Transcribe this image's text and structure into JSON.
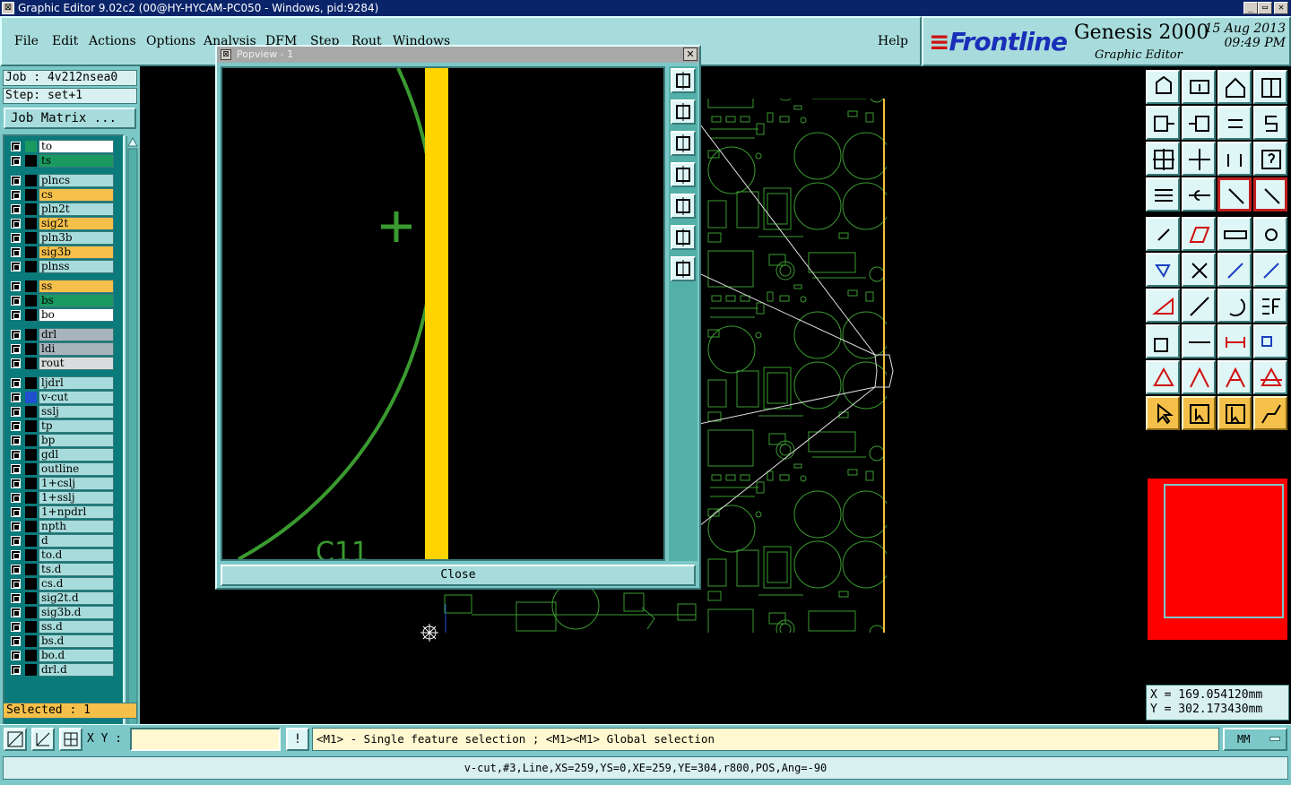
{
  "window": {
    "title": "Graphic Editor 9.02c2 (00@HY-HYCAM-PC050 - Windows, pid:9284)",
    "min_glyph": "_",
    "max_glyph": "▭",
    "close_glyph": "✕"
  },
  "menu": {
    "file": "File",
    "edit": "Edit",
    "actions": "Actions",
    "options": "Options",
    "analysis": "Analysis",
    "dfm": "DFM",
    "step": "Step",
    "rout": "Rout",
    "windows": "Windows",
    "help": "Help"
  },
  "brand": {
    "logo_stripes": "≡",
    "logo": "Frontline",
    "product": "Genesis 2000",
    "subtitle": "Graphic Editor",
    "date": "15 Aug 2013",
    "time": "09:49 PM"
  },
  "job": {
    "job_label": "Job : 4v212nsea0",
    "step_label": "Step: set+1",
    "matrix_button": "Job Matrix ..."
  },
  "layers": [
    {
      "name": "to",
      "color": "#ffffff",
      "swatch": "#1a9a60"
    },
    {
      "name": "ts",
      "color": "#1a9a60",
      "swatch": "#000000"
    },
    {
      "name": "plncs",
      "color": "#a8dcdc",
      "swatch": "#000000"
    },
    {
      "name": "cs",
      "color": "#f5c04a",
      "swatch": "#000000"
    },
    {
      "name": "pln2t",
      "color": "#a8dcdc",
      "swatch": "#000000"
    },
    {
      "name": "sig2t",
      "color": "#f5c04a",
      "swatch": "#000000"
    },
    {
      "name": "pln3b",
      "color": "#a8dcdc",
      "swatch": "#000000"
    },
    {
      "name": "sig3b",
      "color": "#f5c04a",
      "swatch": "#000000"
    },
    {
      "name": "plnss",
      "color": "#a8dcdc",
      "swatch": "#000000"
    },
    {
      "name": "ss",
      "color": "#f5c04a",
      "swatch": "#000000"
    },
    {
      "name": "bs",
      "color": "#1a9a60",
      "swatch": "#000000"
    },
    {
      "name": "bo",
      "color": "#ffffff",
      "swatch": "#000000"
    },
    {
      "name": "drl",
      "color": "#a8b4bc",
      "swatch": "#000000"
    },
    {
      "name": "ldi",
      "color": "#a8b4bc",
      "swatch": "#000000"
    },
    {
      "name": "rout",
      "color": "#d8dcdc",
      "swatch": "#000000"
    },
    {
      "name": "ljdrl",
      "color": "#a8dcdc",
      "swatch": "#000000"
    },
    {
      "name": "v-cut",
      "color": "#a8dcdc",
      "swatch": "#2050d0"
    },
    {
      "name": "sslj",
      "color": "#a8dcdc",
      "swatch": "#000000"
    },
    {
      "name": "tp",
      "color": "#a8dcdc",
      "swatch": "#000000"
    },
    {
      "name": "bp",
      "color": "#a8dcdc",
      "swatch": "#000000"
    },
    {
      "name": "gdl",
      "color": "#a8dcdc",
      "swatch": "#000000"
    },
    {
      "name": "outline",
      "color": "#a8dcdc",
      "swatch": "#000000"
    },
    {
      "name": "1+cslj",
      "color": "#a8dcdc",
      "swatch": "#000000"
    },
    {
      "name": "1+sslj",
      "color": "#a8dcdc",
      "swatch": "#000000"
    },
    {
      "name": "1+npdrl",
      "color": "#a8dcdc",
      "swatch": "#000000"
    },
    {
      "name": "npth",
      "color": "#a8dcdc",
      "swatch": "#000000"
    },
    {
      "name": "d",
      "color": "#a8dcdc",
      "swatch": "#000000"
    },
    {
      "name": "to.d",
      "color": "#a8dcdc",
      "swatch": "#000000"
    },
    {
      "name": "ts.d",
      "color": "#a8dcdc",
      "swatch": "#000000"
    },
    {
      "name": "cs.d",
      "color": "#a8dcdc",
      "swatch": "#000000"
    },
    {
      "name": "sig2t.d",
      "color": "#a8dcdc",
      "swatch": "#000000"
    },
    {
      "name": "sig3b.d",
      "color": "#a8dcdc",
      "swatch": "#000000"
    },
    {
      "name": "ss.d",
      "color": "#a8dcdc",
      "swatch": "#000000"
    },
    {
      "name": "bs.d",
      "color": "#a8dcdc",
      "swatch": "#000000"
    },
    {
      "name": "bo.d",
      "color": "#a8dcdc",
      "swatch": "#000000"
    },
    {
      "name": "drl.d",
      "color": "#a8dcdc",
      "swatch": "#000000"
    }
  ],
  "selected": "Selected : 1",
  "popview": {
    "title": "Popview - 1",
    "label_text": "C11",
    "close_button": "Close"
  },
  "coords": {
    "x": "X = 169.054120mm",
    "y": "Y = 302.173430mm"
  },
  "command": {
    "xy_label": "X Y :",
    "xy_value": "",
    "info_glyph": "!",
    "message": "<M1> - Single feature selection ; <M1><M1> Global selection",
    "units": "MM"
  },
  "status": "v-cut,#3,Line,XS=259,YS=0,XE=259,YE=304,r800,POS,Ang=-90",
  "toolbar_icons": [
    "home-icon",
    "home-out-icon",
    "house-icon",
    "split-window-icon",
    "step-left-icon",
    "step-right-icon",
    "swap-icon",
    "s-curve-icon",
    "zoom-fit-icon",
    "pan-icon",
    "scale-1-2-icon",
    "help-query-icon",
    "sliders-icon",
    "probe-icon",
    "layers-red-icon",
    "layers-red-2-icon",
    "arrow-pad-icon",
    "parallelogram-icon",
    "ruler-icon",
    "pad-dot-icon",
    "nodes-icon",
    "cross-icon",
    "link-icon",
    "link-red-icon",
    "angle-icon",
    "line-icon",
    "arc-icon",
    "text-f-icon",
    "square-dot-icon",
    "dash-icon",
    "dimension-icon",
    "shapes-blue-icon",
    "triangle-red-icon",
    "triangle-outline-icon",
    "triangle-a-icon",
    "triangle-cut-icon",
    "pointer-icon",
    "pointer-box-icon",
    "pointer-highlight-icon",
    "route-icon"
  ],
  "colors": {
    "panel_cyan": "#7cc8c8",
    "button_cyan": "#a8dcdc",
    "pcb_green": "#3a9a30",
    "trace_yellow": "#ffd400",
    "outline_orange": "#f0c040",
    "minimap_red": "#ff0000"
  }
}
